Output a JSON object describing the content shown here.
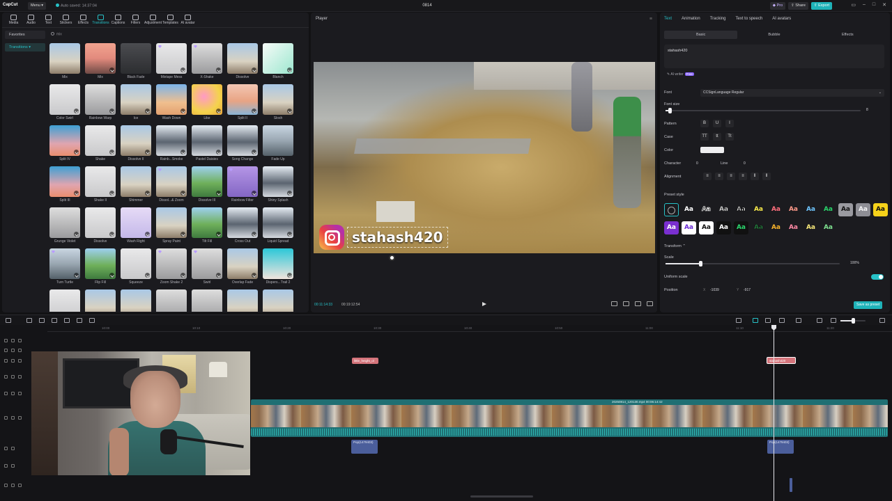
{
  "app": {
    "logo": "CapCut",
    "menu_label": "Menu",
    "autosave": "Auto saved: 14:37:04",
    "project_title": "0814",
    "pro_label": "Pro",
    "share_label": "Share",
    "export_label": "Export"
  },
  "toolbar": {
    "tabs": [
      {
        "label": "Media",
        "icon": "media-icon"
      },
      {
        "label": "Audio",
        "icon": "audio-icon"
      },
      {
        "label": "Text",
        "icon": "text-icon"
      },
      {
        "label": "Stickers",
        "icon": "stickers-icon"
      },
      {
        "label": "Effects",
        "icon": "effects-icon"
      },
      {
        "label": "Transitions",
        "icon": "transitions-icon",
        "active": true
      },
      {
        "label": "Captions",
        "icon": "captions-icon"
      },
      {
        "label": "Filters",
        "icon": "filters-icon"
      },
      {
        "label": "Adjustment",
        "icon": "adjustment-icon"
      },
      {
        "label": "Templates",
        "icon": "templates-icon"
      },
      {
        "label": "AI avatar",
        "icon": "ai-avatar-icon"
      }
    ]
  },
  "sidebar": {
    "favorites": "Favorites",
    "transitions": "Transitions"
  },
  "search": {
    "text": "mix"
  },
  "transitions": [
    {
      "label": "Mix",
      "thumb": "t-sky",
      "dl": false,
      "gem": false
    },
    {
      "label": "Mix",
      "thumb": "t-pink",
      "dl": true,
      "gem": false
    },
    {
      "label": "Black Fade",
      "thumb": "t-dark",
      "dl": false,
      "gem": false
    },
    {
      "label": "Mixtape Mess",
      "thumb": "t-person",
      "dl": true,
      "gem": true
    },
    {
      "label": "X-Shake",
      "thumb": "t-face",
      "dl": true,
      "gem": true
    },
    {
      "label": "Dissolve",
      "thumb": "t-sky",
      "dl": true,
      "gem": false
    },
    {
      "label": "Blanch",
      "thumb": "t-white",
      "dl": true,
      "gem": false
    },
    {
      "label": "Color Swirl",
      "thumb": "t-person",
      "dl": true,
      "gem": false
    },
    {
      "label": "Rainbow Warp",
      "thumb": "t-face",
      "dl": true,
      "gem": false
    },
    {
      "label": "Ice",
      "thumb": "t-sky",
      "dl": true,
      "gem": false
    },
    {
      "label": "Wash Down",
      "thumb": "t-blue",
      "dl": true,
      "gem": false
    },
    {
      "label": "Like",
      "thumb": "t-yellow",
      "dl": true,
      "gem": false
    },
    {
      "label": "Split II",
      "thumb": "t-tower",
      "dl": true,
      "gem": false
    },
    {
      "label": "Slosh",
      "thumb": "t-sky",
      "dl": true,
      "gem": false
    },
    {
      "label": "Split IV",
      "thumb": "t-teal",
      "dl": true,
      "gem": false
    },
    {
      "label": "Shake",
      "thumb": "t-person",
      "dl": true,
      "gem": false
    },
    {
      "label": "Dissolve II",
      "thumb": "t-sky",
      "dl": true,
      "gem": false
    },
    {
      "label": "Rainb...Smoke",
      "thumb": "t-mtn",
      "dl": true,
      "gem": false
    },
    {
      "label": "Pastel Daisies",
      "thumb": "t-mtn",
      "dl": true,
      "gem": false
    },
    {
      "label": "Song Change",
      "thumb": "t-mtn",
      "dl": true,
      "gem": false
    },
    {
      "label": "Fade Up",
      "thumb": "t-car",
      "dl": false,
      "gem": false
    },
    {
      "label": "Split III",
      "thumb": "t-teal",
      "dl": true,
      "gem": false
    },
    {
      "label": "Shake II",
      "thumb": "t-person",
      "dl": true,
      "gem": false
    },
    {
      "label": "Shimmer",
      "thumb": "t-sky",
      "dl": true,
      "gem": false
    },
    {
      "label": "Dissol...& Zoom",
      "thumb": "t-sky",
      "dl": true,
      "gem": true
    },
    {
      "label": "Dissolve III",
      "thumb": "t-green",
      "dl": true,
      "gem": false
    },
    {
      "label": "Rainbow Filter",
      "thumb": "t-purple",
      "dl": true,
      "gem": true
    },
    {
      "label": "Shiny Splash",
      "thumb": "t-mtn",
      "dl": true,
      "gem": false
    },
    {
      "label": "Grunge Violet",
      "thumb": "t-face",
      "dl": true,
      "gem": false
    },
    {
      "label": "Dissolve",
      "thumb": "t-person",
      "dl": true,
      "gem": false
    },
    {
      "label": "Wash Right",
      "thumb": "t-lav",
      "dl": true,
      "gem": false
    },
    {
      "label": "Spray Paint",
      "thumb": "t-sky",
      "dl": true,
      "gem": false
    },
    {
      "label": "Tilt Fill",
      "thumb": "t-green",
      "dl": true,
      "gem": false
    },
    {
      "label": "Cross Out",
      "thumb": "t-mtn",
      "dl": true,
      "gem": false
    },
    {
      "label": "Liquid Spread",
      "thumb": "t-mtn",
      "dl": true,
      "gem": false
    },
    {
      "label": "Turn Turtle",
      "thumb": "t-car",
      "dl": true,
      "gem": true
    },
    {
      "label": "Flip Fill",
      "thumb": "t-green",
      "dl": true,
      "gem": false
    },
    {
      "label": "Squeeze",
      "thumb": "t-person",
      "dl": true,
      "gem": false
    },
    {
      "label": "Zoom Shake 2",
      "thumb": "t-face",
      "dl": true,
      "gem": true
    },
    {
      "label": "Swirl",
      "thumb": "t-face",
      "dl": true,
      "gem": true
    },
    {
      "label": "Overlap Fade",
      "thumb": "t-sky",
      "dl": true,
      "gem": false
    },
    {
      "label": "Dispers...Trail 2",
      "thumb": "t-cyan",
      "dl": true,
      "gem": false
    },
    {
      "label": "",
      "thumb": "t-person",
      "dl": false,
      "gem": false
    },
    {
      "label": "",
      "thumb": "t-sky",
      "dl": false,
      "gem": false
    },
    {
      "label": "",
      "thumb": "t-sky",
      "dl": false,
      "gem": false
    },
    {
      "label": "",
      "thumb": "t-face",
      "dl": false,
      "gem": false
    },
    {
      "label": "",
      "thumb": "t-face",
      "dl": false,
      "gem": false
    },
    {
      "label": "",
      "thumb": "t-sky",
      "dl": false,
      "gem": false
    },
    {
      "label": "",
      "thumb": "t-sky",
      "dl": false,
      "gem": false
    }
  ],
  "player": {
    "title": "Player",
    "overlay_text": "stahash420",
    "time_current": "00:11:14:33",
    "time_total": "00:19:12:54"
  },
  "props": {
    "tabs": [
      "Text",
      "Animation",
      "Tracking",
      "Text to speech",
      "AI avatars"
    ],
    "subtabs": [
      "Basic",
      "Bubble",
      "Effects"
    ],
    "text_value": "stahash420",
    "ai_writer": "AI writer",
    "ai_badge": "Free",
    "font_label": "Font",
    "font_value": "CCSignLanguage Regular",
    "font_size_label": "Font size",
    "font_size_value": "8",
    "font_size_level": 0.02,
    "pattern_label": "Pattern",
    "pattern_buttons": [
      "B",
      "U",
      "I"
    ],
    "case_label": "Case",
    "case_buttons": [
      "TT",
      "tt",
      "Tt"
    ],
    "color_label": "Color",
    "color_value": "#eeeef0",
    "character_label": "Character",
    "character_value": "0",
    "line_label": "Line",
    "line_value": "0",
    "alignment_label": "Alignment",
    "preset_label": "Preset style",
    "presets": [
      {
        "t": "",
        "bg": "transparent",
        "fg": "#aaa",
        "none": true
      },
      {
        "t": "Aa",
        "bg": "transparent",
        "fg": "#ffffff"
      },
      {
        "t": "Aa",
        "bg": "transparent",
        "fg": "#222222",
        "stroke": "#ffffff"
      },
      {
        "t": "Aa",
        "bg": "transparent",
        "fg": "#ffffff",
        "stroke": "#444"
      },
      {
        "t": "Aa",
        "bg": "transparent",
        "fg": "#ffffff",
        "stroke": "#000"
      },
      {
        "t": "Aa",
        "bg": "transparent",
        "fg": "#f7e94a"
      },
      {
        "t": "Aa",
        "bg": "transparent",
        "fg": "#ff6f7d"
      },
      {
        "t": "Aa",
        "bg": "transparent",
        "fg": "#ff9a8a"
      },
      {
        "t": "Aa",
        "bg": "transparent",
        "fg": "#6fc6ff"
      },
      {
        "t": "Aa",
        "bg": "transparent",
        "fg": "#29d36a"
      },
      {
        "t": "Aa",
        "bg": "#9a9aa0",
        "fg": "#111111"
      },
      {
        "t": "Aa",
        "bg": "#8e8e95",
        "fg": "#f2f2f4"
      },
      {
        "t": "Aa",
        "bg": "#f6d21a",
        "fg": "#111111"
      },
      {
        "t": "Aa",
        "bg": "#7a2fd0",
        "fg": "#ffffff"
      },
      {
        "t": "Aa",
        "bg": "#ffffff",
        "fg": "#6a2bd6"
      },
      {
        "t": "Aa",
        "bg": "#ffffff",
        "fg": "#111111"
      },
      {
        "t": "Aa",
        "bg": "#111111",
        "fg": "#ffffff"
      },
      {
        "t": "Aa",
        "bg": "#111111",
        "fg": "#2bd66e"
      },
      {
        "t": "Aa",
        "bg": "transparent",
        "fg": "#2aa64e",
        "stroke": "#111"
      },
      {
        "t": "Aa",
        "bg": "transparent",
        "fg": "#f6b22b"
      },
      {
        "t": "Aa",
        "bg": "transparent",
        "fg": "#ff8aa6"
      },
      {
        "t": "Aa",
        "bg": "transparent",
        "fg": "#f8e97a"
      },
      {
        "t": "Aa",
        "bg": "transparent",
        "fg": "#7ee08f"
      }
    ],
    "transform_label": "Transform",
    "scale_label": "Scale",
    "scale_value": "100%",
    "scale_level": 0.2,
    "uniform_label": "Uniform scale",
    "position_label": "Position",
    "pos_x_label": "X",
    "pos_x": "-1039",
    "pos_y_label": "Y",
    "pos_y": "-917",
    "save_preset": "Save as preset"
  },
  "timeline": {
    "ruler": [
      "10:00",
      "10:10",
      "10:20",
      "10:30",
      "10:40",
      "10:50",
      "11:00",
      "11:10",
      "11:20"
    ],
    "text_clips": [
      {
        "label": "little_height_ol"
      },
      {
        "label": "stahash420",
        "selected": true
      }
    ],
    "main_clip_label": "20250814_120130.mp4  00:06:14:42",
    "audio_clips": [
      {
        "label": "Pop(1479403)"
      },
      {
        "label": "Pop(1479403)"
      }
    ]
  },
  "colors": {
    "accent": "#27c2c8",
    "text_clip": "#d4747b",
    "audio_clip": "#4b5e9b",
    "video_clip": "#1f6f73"
  }
}
